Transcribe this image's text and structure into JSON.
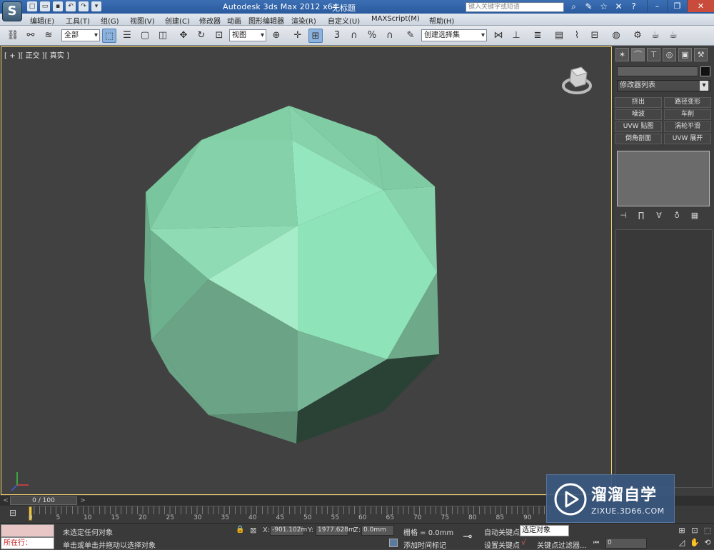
{
  "title_bar": {
    "app_title": "Autodesk 3ds Max  2012 x64",
    "file_title": "无标题",
    "search_placeholder": "键入关键字或短语"
  },
  "menu": [
    "编辑(E)",
    "工具(T)",
    "组(G)",
    "视图(V)",
    "创建(C)",
    "修改器",
    "动画",
    "图形编辑器",
    "渲染(R)",
    "自定义(U)",
    "MAXScript(M)",
    "帮助(H)"
  ],
  "toolbar": {
    "selection_filter": "全部",
    "reference_coord": "视图",
    "named_selection": "创建选择集",
    "snap_3": "3",
    "percent_snap": "%"
  },
  "viewport": {
    "label": "[ + ][ 正交 ][ 真实 ]",
    "object_color": "#8fdcb4"
  },
  "command_panel": {
    "modifier_list": "修改器列表",
    "modifier_buttons": [
      "挤出",
      "路径变形",
      "噪波",
      "车削",
      "UVW 贴图",
      "涡轮平滑",
      "倒角剖面",
      "UVW 展开"
    ]
  },
  "timeline": {
    "frame_slider": "0 / 100",
    "ticks": [
      "0",
      "5",
      "10",
      "15",
      "20",
      "25",
      "30",
      "35",
      "40",
      "45",
      "50",
      "55",
      "60",
      "65",
      "70",
      "75",
      "80",
      "85",
      "90"
    ]
  },
  "status_bar": {
    "maxscript_label": "所在行：",
    "status_line_1": "未选定任何对象",
    "status_line_2": "单击或单击并拖动以选择对象",
    "x_label": "X:",
    "x_value": "-901.102m",
    "y_label": "Y:",
    "y_value": "1977.628m",
    "z_label": "Z:",
    "z_value": "0.0mm",
    "grid": "栅格 = 0.0mm",
    "add_time_tag": "添加时间标记",
    "auto_key": "自动关键点",
    "set_key": "设置关键点",
    "key_mode": "选定对象",
    "key_filters": "关键点过滤器...",
    "current_frame": "0"
  },
  "watermark": {
    "title": "溜溜自学",
    "url": "ZIXUE.3D66.COM"
  }
}
